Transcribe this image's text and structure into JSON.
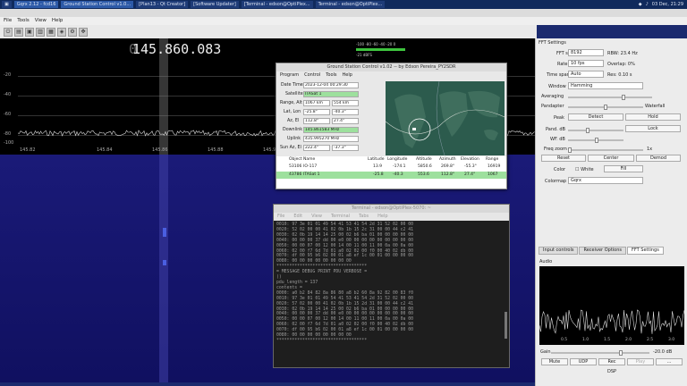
{
  "taskbar": {
    "items": [
      "Gqrx 2.12 - fcd16",
      "Ground Station Control v1.0...",
      "[Plan13 - Qt Creator]",
      "[Software Updater]",
      "[Terminal - edson@OptiPlex...",
      "Terminal - edson@OptiPlex..."
    ],
    "clock": "03 Dec, 21:29"
  },
  "gqrx": {
    "menu": [
      "File",
      "Tools",
      "View",
      "Help"
    ],
    "frequency_prefix": "0",
    "frequency": "145.860.083",
    "spectrum_ylabels": [
      "-20",
      "-40",
      "-60",
      "-80",
      "-100"
    ],
    "spectrum_xlabels": [
      "145.82",
      "145.84",
      "145.86",
      "145.88",
      "145.90"
    ],
    "meter": {
      "scale": "-100  -80  -60  -40  -20  0",
      "value": "-21 dBFS"
    }
  },
  "fft_settings": {
    "title": "FFT Settings",
    "fft_size_label": "FFT size",
    "fft_size": "8192",
    "rbw": "RBW: 23.4 Hz",
    "rate_label": "Rate",
    "rate": "10 fps",
    "overlap": "Overlap: 0%",
    "timespan_label": "Time span",
    "timespan": "Auto",
    "res": "Res: 0.10 s",
    "window_label": "Window",
    "window": "Hamming",
    "averaging_label": "Averaging",
    "pandapter_label": "Pandapter",
    "waterfall_label": "Waterfall",
    "peak_label": "Peak",
    "detect_label": "Detect",
    "hold_label": "Hold",
    "pand_label": "Pand. dB",
    "lock_label": "Lock",
    "wf_label": "WF. dB",
    "zoom_label": "Freq zoom",
    "zoom_value": "1x",
    "reset_label": "Reset",
    "center_label": "Center",
    "demod_label": "Demod",
    "color_label": "Color",
    "white_label": "White",
    "fill_label": "Fill",
    "colormap_label": "Colormap",
    "colormap": "Gqrx",
    "tabs": [
      "Input controls",
      "Receiver Options",
      "FFT Settings"
    ],
    "audio_title": "Audio",
    "audio_xlabels": [
      "0.5",
      "1.0",
      "1.5",
      "2.0",
      "2.5",
      "3.0"
    ],
    "gain_label": "Gain",
    "gain_value": "-20.0 dB",
    "buttons": [
      "Mute",
      "UDP",
      "Rec",
      "Play",
      "..."
    ],
    "dsp_label": "DSP"
  },
  "gsc": {
    "title": "Ground Station Control v1.02 -- by Edson Pereira_PY2SDR",
    "menu": [
      "Program",
      "Control",
      "Tools",
      "Help"
    ],
    "fields": [
      {
        "label": "Date Time",
        "v1": "2023-12-04 00:29:30",
        "v2": ""
      },
      {
        "label": "Satellite",
        "v1": "ITASat 1",
        "v2": ""
      },
      {
        "label": "Range, Alt",
        "v1": "1067 km",
        "v2": "554 km"
      },
      {
        "label": "Lat, Lon",
        "v1": "-25.8°",
        "v2": "-40.3°"
      },
      {
        "label": "Az, El",
        "v1": "112.8°",
        "v2": "27.4°"
      },
      {
        "label": "Downlink",
        "v1": "145.861583 MHz",
        "v2": ""
      },
      {
        "label": "Uplink",
        "v1": "435.995270 MHz",
        "v2": ""
      },
      {
        "label": "Sun Az, El",
        "v1": "222.4°",
        "v2": "-37.3°"
      }
    ],
    "table_headers": [
      "Object",
      "Name",
      "Latitude",
      "Longitude",
      "Altitude",
      "Azimuth",
      "Elevation",
      "Range"
    ],
    "rows": [
      [
        "53106",
        "IO-117",
        "13.9",
        "-174.1",
        "5850.6",
        "269.8°",
        "-55.3°",
        "16919"
      ],
      [
        "43786",
        "ITASat 1",
        "-25.8",
        "-40.3",
        "553.6",
        "112.8°",
        "27.4°",
        "1067"
      ]
    ]
  },
  "terminal": {
    "title": "Terminal - edson@OptiPlex-5070: ~",
    "menu": [
      "File",
      "Edit",
      "View",
      "Terminal",
      "Tabs",
      "Help"
    ],
    "lines": [
      "0010: 97 3e 01 01 49 54 41 53 41 54 2d 31 52 02 00 00",
      "0020: 52 02 00 00 41 02 0b 1b 15 2c 31 00 00 44 c2 41",
      "0030: 02 0b 19 14 14 25 00 02 b6 ba 01 00 00 00 00 00",
      "0040: 00 00 00 37 dd 00 e0 00 00 00 00 00 00 00 00 00",
      "0050: 00 00 07 00 12 00 14 00 11 00 11 00 0a 00 0a 00",
      "0060: 02 00 f7 6d 7d 01 a0 02 02 00 f0 00 40 02 db 00",
      "0070: df 00 95 b6 02 00 01 a8 ef 1c 00 01 00 00 00 00",
      "0080: 00 00 00 00 00 00 00 00",
      "***********************************",
      "= MESSAGE DEBUG PRINT PDU VERBOSE =",
      "()",
      "pdu_length = 137",
      "contents =",
      "0000: a0 b2 84 82 8a 86 80 a8 b2 60 8a 92 82 00 83 f0",
      "0010: 97 3e 01 01 49 54 41 53 41 54 2d 31 52 02 00 00",
      "0020: 57 02 00 00 41 02 0b 1b 15 2d 31 00 00 44 c2 41",
      "0030: 02 0b 19 14 14 25 00 02 b6 ba 01 00 00 00 00 00",
      "0040: 00 00 00 37 dd 00 e0 00 00 00 00 00 00 00 00 00",
      "0050: 00 00 07 00 12 00 14 00 11 00 11 00 0a 00 0a 00",
      "0060: 02 00 f7 6d 7d 01 a0 02 02 00 f0 00 40 02 db 00",
      "0070: df 00 95 b6 02 00 01 a8 ef 1c 00 01 00 00 00 00",
      "0080: 00 00 00 00 00 00 00 00",
      "***********************************"
    ]
  },
  "colors": {
    "accent": "#2d5aa8",
    "highlight": "#9de09d",
    "waterfall": "#1a1a78",
    "map": "#2c5b4d"
  },
  "icons": [
    "app-menu-icon",
    "open-icon",
    "save-icon",
    "record-icon",
    "settings-icon",
    "clock-icon"
  ]
}
